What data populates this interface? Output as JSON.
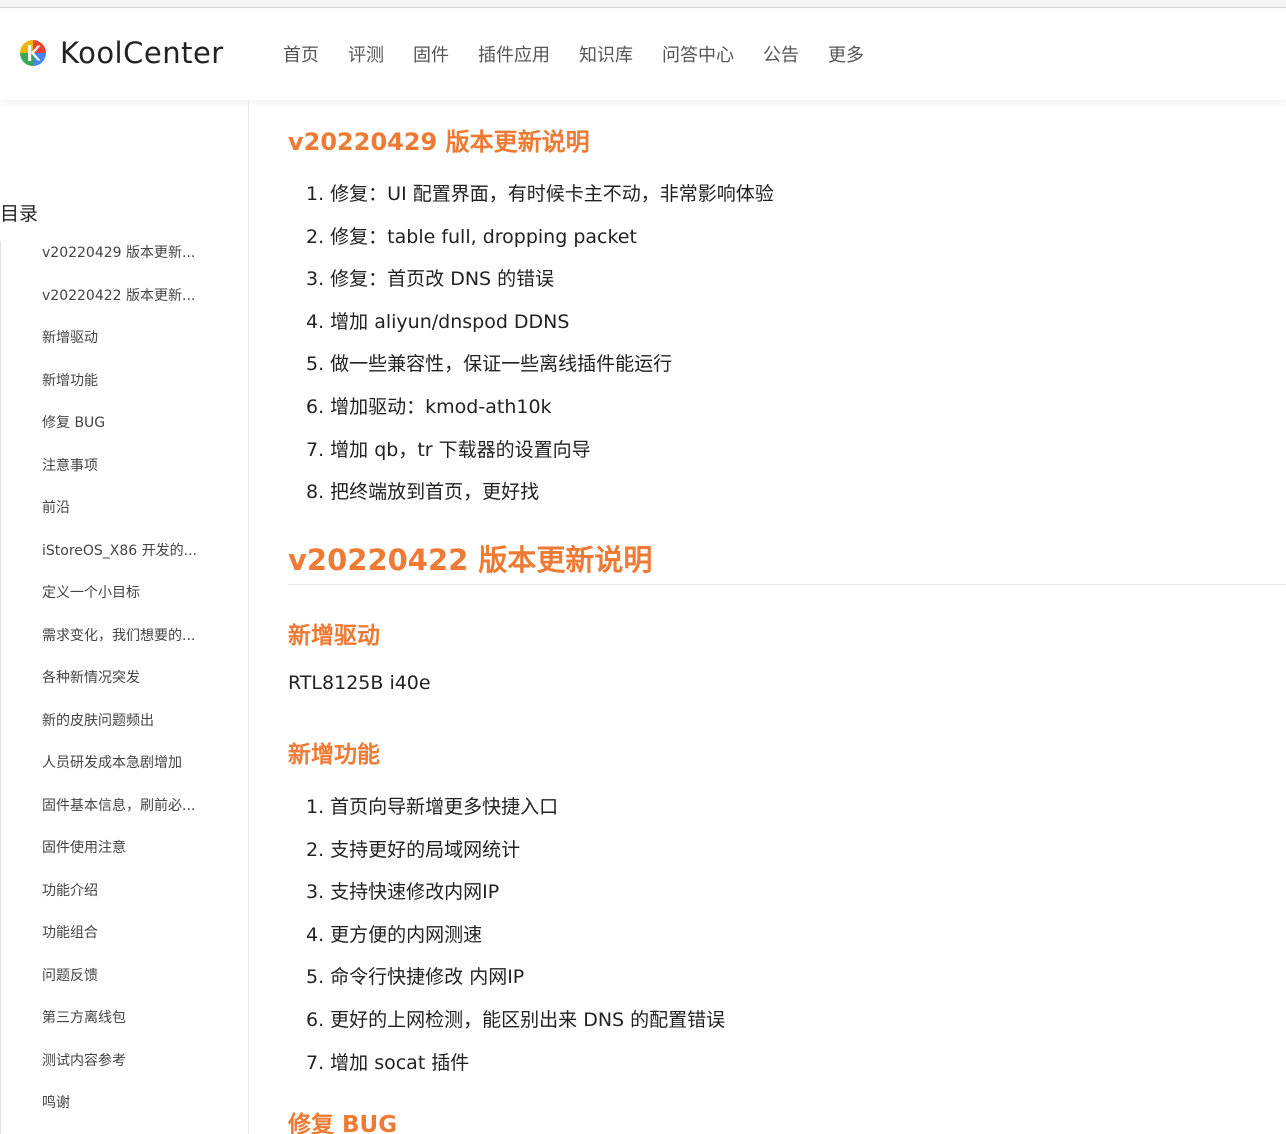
{
  "header": {
    "logo_text": "KoolCenter",
    "nav": [
      "首页",
      "评测",
      "固件",
      "插件应用",
      "知识库",
      "问答中心",
      "公告",
      "更多"
    ]
  },
  "sidebar": {
    "title": "目录",
    "items": [
      "v20220429 版本更新...",
      "v20220422 版本更新...",
      "新增驱动",
      "新增功能",
      "修复 BUG",
      "注意事项",
      "前沿",
      "iStoreOS_X86 开发的...",
      "定义一个小目标",
      "需求变化，我们想要的...",
      "各种新情况突发",
      "新的皮肤问题频出",
      "人员研发成本急剧增加",
      "固件基本信息，刷前必...",
      "固件使用注意",
      "功能介绍",
      "功能组合",
      "问题反馈",
      "第三方离线包",
      "测试内容参考",
      "鸣谢"
    ]
  },
  "content": {
    "section1": {
      "title": "v20220429 版本更新说明",
      "items": [
        "1. 修复：UI 配置界面，有时候卡主不动，非常影响体验",
        "2. 修复：table full, dropping packet",
        "3. 修复：首页改 DNS 的错误",
        "4. 增加 aliyun/dnspod DDNS",
        "5. 做一些兼容性，保证一些离线插件能运行",
        "6. 增加驱动：kmod-ath10k",
        "7. 增加 qb，tr 下载器的设置向导",
        "8. 把终端放到首页，更好找"
      ]
    },
    "section2": {
      "title": "v20220422 版本更新说明",
      "drivers_title": "新增驱动",
      "drivers_text": "RTL8125B i40e",
      "features_title": "新增功能",
      "features": [
        "1. 首页向导新增更多快捷入口",
        "2. 支持更好的局域网统计",
        "3. 支持快速修改内网IP",
        "4. 更方便的内网测速",
        "5. 命令行快捷修改 内网IP",
        "6. 更好的上网检测，能区别出来 DNS 的配置错误",
        "7. 增加 socat 插件"
      ],
      "bugfix_title": "修复 BUG"
    }
  }
}
